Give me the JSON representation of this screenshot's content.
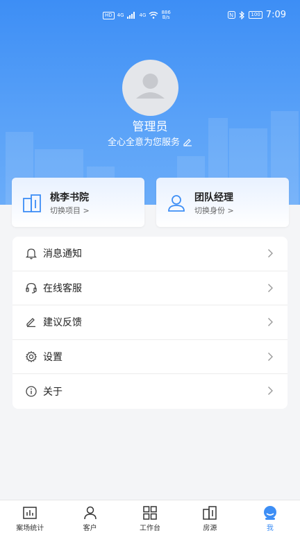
{
  "status_bar": {
    "network_tag": "HD",
    "signal_tags": [
      "4G",
      "4G"
    ],
    "speed_value": "886",
    "speed_unit": "B/s",
    "battery": "100",
    "time": "7:09"
  },
  "profile": {
    "name": "管理员",
    "motto": "全心全意为您服务"
  },
  "cards": [
    {
      "title": "桃李书院",
      "subtitle": "切换项目 >"
    },
    {
      "title": "团队经理",
      "subtitle": "切换身份 >"
    }
  ],
  "menu": [
    {
      "label": "消息通知"
    },
    {
      "label": "在线客服"
    },
    {
      "label": "建议反馈"
    },
    {
      "label": "设置"
    },
    {
      "label": "关于"
    }
  ],
  "tabs": [
    {
      "label": "案场统计"
    },
    {
      "label": "客户"
    },
    {
      "label": "工作台"
    },
    {
      "label": "房源"
    },
    {
      "label": "我"
    }
  ],
  "colors": {
    "accent": "#3d8ef5",
    "icon_stroke": "#444444"
  }
}
